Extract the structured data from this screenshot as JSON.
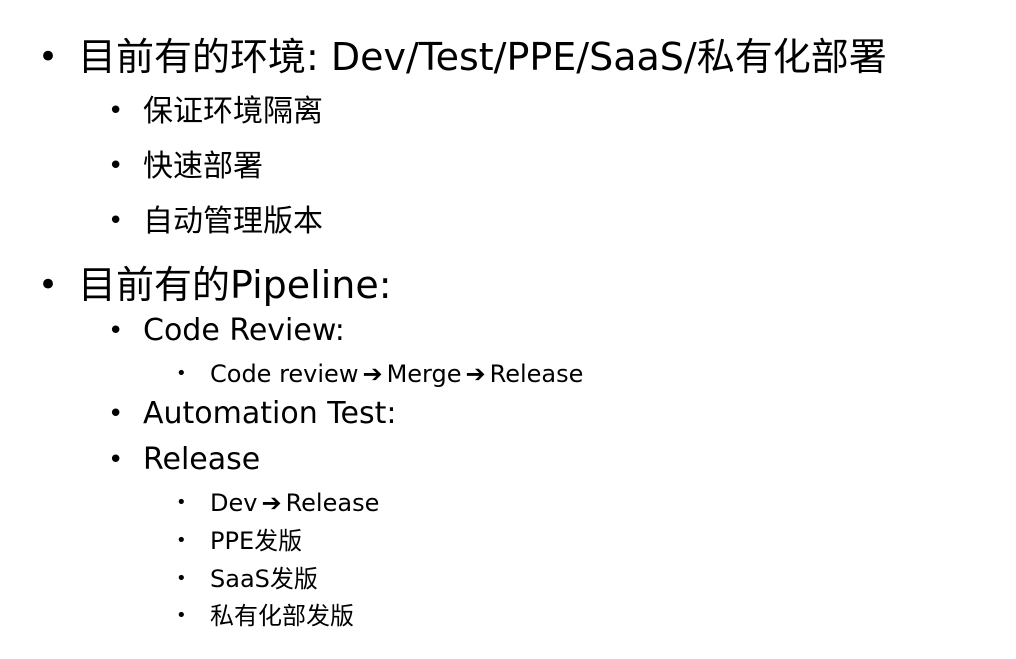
{
  "bullet_char": "•",
  "arrow_char": "➔",
  "section1": {
    "heading": "目前有的环境: Dev/Test/PPE/SaaS/私有化部署",
    "items": [
      "保证环境隔离",
      "快速部署",
      "自动管理版本"
    ]
  },
  "section2": {
    "heading": "目前有的Pipeline:",
    "code_review": {
      "label": "Code Review:",
      "flow": [
        "Code review",
        "Merge",
        "Release"
      ]
    },
    "automation_test": {
      "label": "Automation Test:"
    },
    "release": {
      "label": "Release",
      "flow": [
        "Dev",
        "Release"
      ],
      "items": [
        "PPE发版",
        "SaaS发版",
        "私有化部发版"
      ]
    }
  }
}
